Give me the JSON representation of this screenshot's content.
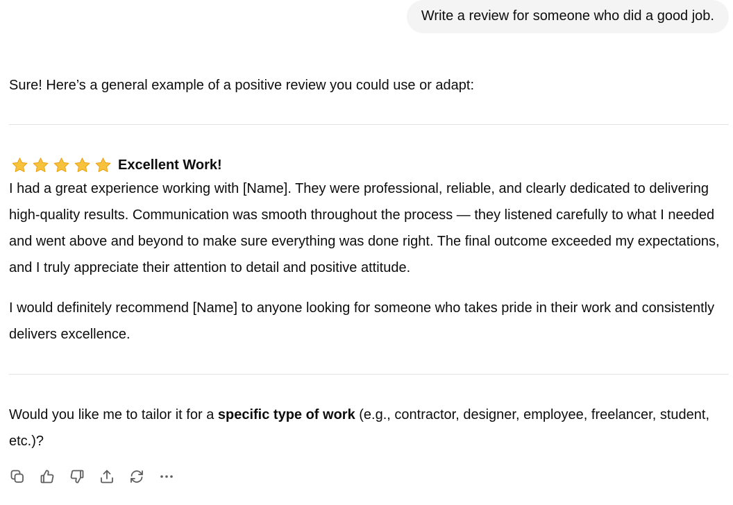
{
  "user_message": "Write a review for someone who did a good job.",
  "assistant": {
    "intro": "Sure! Here’s a general example of a positive review you could use or adapt:",
    "review": {
      "stars": 5,
      "star_glyph": "⭐",
      "title": "Excellent Work!",
      "paragraph1": "I had a great experience working with [Name]. They were professional, reliable, and clearly dedicated to delivering high-quality results. Communication was smooth throughout the process — they listened carefully to what I needed and went above and beyond to make sure everything was done right. The final outcome exceeded my expectations, and I truly appreciate their attention to detail and positive attitude.",
      "paragraph2": "I would definitely recommend [Name] to anyone looking for someone who takes pride in their work and consistently delivers excellence."
    },
    "question": {
      "before": "Would you like me to tailor it for a ",
      "bold": "specific type of work",
      "after": " (e.g., contractor, designer, employee, freelancer, student, etc.)?"
    }
  },
  "actions": [
    {
      "name": "copy-icon"
    },
    {
      "name": "thumbs-up-icon"
    },
    {
      "name": "thumbs-down-icon"
    },
    {
      "name": "share-icon"
    },
    {
      "name": "regenerate-icon"
    },
    {
      "name": "more-icon"
    }
  ],
  "colors": {
    "star_fill": "#F9C23C",
    "star_stroke": "#E8A317",
    "bubble_bg": "#F4F4F4",
    "divider": "#E3E3E3",
    "text": "#0D0D0D",
    "icon": "#5D5D5D"
  }
}
